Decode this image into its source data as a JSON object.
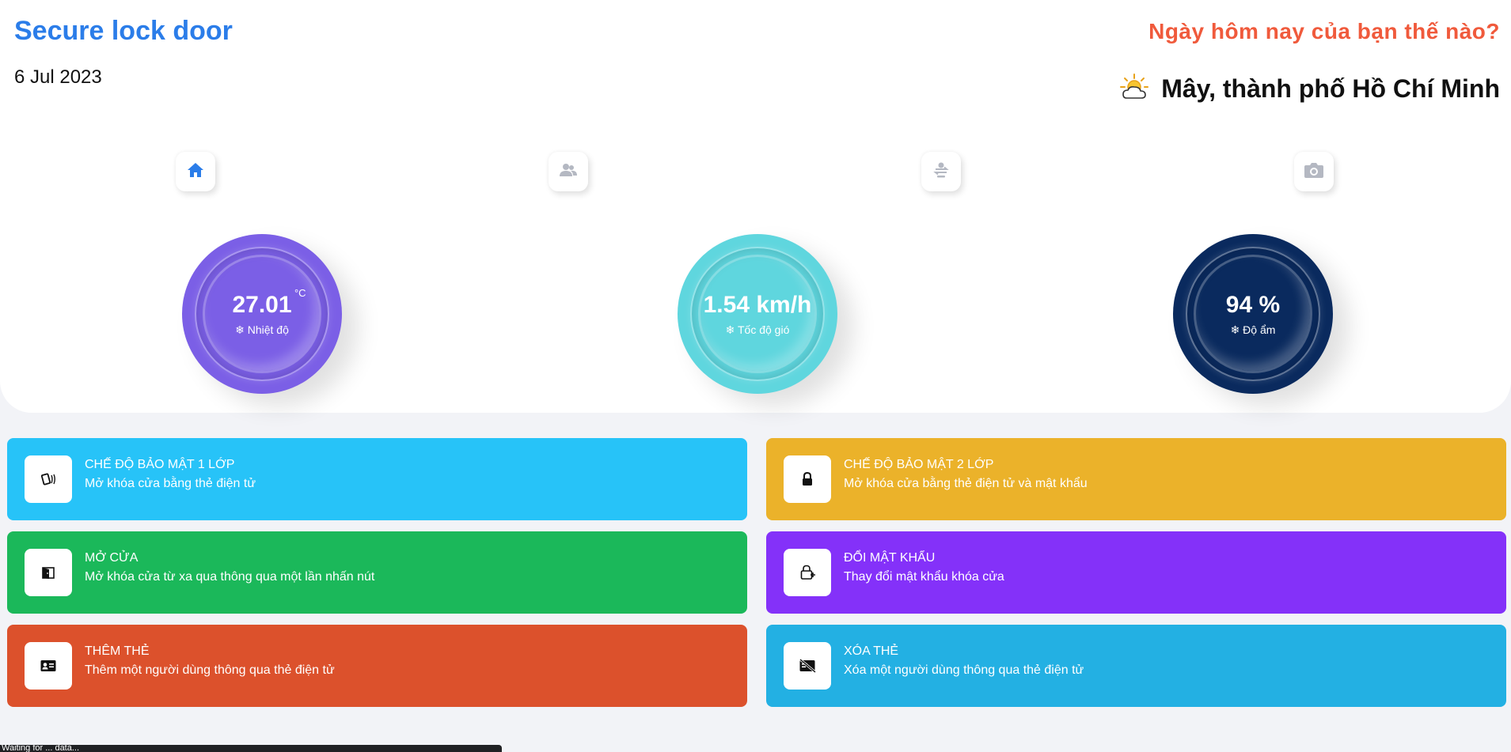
{
  "header": {
    "title": "Secure lock door",
    "date": "6 Jul 2023",
    "greeting": "Ngày hôm nay của bạn thế nào?",
    "weather_text": "Mây, thành phố Hồ Chí Minh",
    "weather_icon": "partly-cloudy-icon"
  },
  "nav": [
    {
      "icon": "home-icon",
      "active": true
    },
    {
      "icon": "users-icon",
      "active": false
    },
    {
      "icon": "user-swap-icon",
      "active": false
    },
    {
      "icon": "camera-icon",
      "active": false
    }
  ],
  "gauges": {
    "temperature": {
      "value": "27.01",
      "unit": "°C",
      "label": "❄ Nhiệt độ",
      "color": "#7b5fe6"
    },
    "wind": {
      "value": "1.54 km/h",
      "label": "❄ Tốc độ gió",
      "color": "#5fd6de"
    },
    "humidity": {
      "value": "94 %",
      "label": "❄ Độ ẩm",
      "color": "#0a2a5e"
    }
  },
  "cards": [
    {
      "title": "Chế độ bảo mật 1 lớp",
      "desc": "Mở khóa cửa bằng thẻ điện tử",
      "color": "#27c3f8",
      "icon": "nfc-card-icon"
    },
    {
      "title": "Chế độ bảo mật 2 lớp",
      "desc": "Mở khóa cửa bằng thẻ điện tử và mật khẩu",
      "color": "#ebb22a",
      "icon": "lock-icon"
    },
    {
      "title": "Mở cửa",
      "desc": "Mở khóa cửa từ xa qua thông qua một lần nhấn nút",
      "color": "#1bb85a",
      "icon": "door-open-icon"
    },
    {
      "title": "Đổi mật khẩu",
      "desc": "Thay đổi mật khẩu khóa cửa",
      "color": "#8431f9",
      "icon": "lock-add-icon"
    },
    {
      "title": "Thêm thẻ",
      "desc": "Thêm một người dùng thông qua thẻ điện tử",
      "color": "#dc512c",
      "icon": "id-card-icon"
    },
    {
      "title": "Xóa thẻ",
      "desc": "Xóa một người dùng thông qua thẻ điện tử",
      "color": "#23b0e3",
      "icon": "card-off-icon"
    }
  ],
  "status_bar": {
    "text": "Waiting for ... data..."
  }
}
